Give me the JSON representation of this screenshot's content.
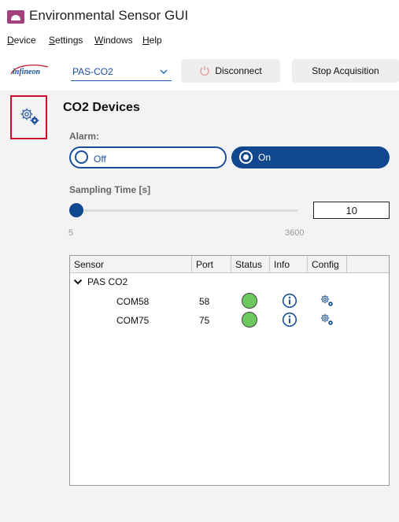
{
  "app": {
    "title": "Environmental Sensor GUI",
    "accent": "#a3417f"
  },
  "menu": {
    "items": [
      {
        "mnemonic": "D",
        "rest": "evice"
      },
      {
        "mnemonic": "S",
        "rest": "ettings"
      },
      {
        "mnemonic": "W",
        "rest": "indows"
      },
      {
        "mnemonic": "H",
        "rest": "elp"
      }
    ]
  },
  "toolbar": {
    "logo_text": "infineon",
    "device_value": "PAS-CO2",
    "disconnect_label": "Disconnect",
    "stop_label": "Stop Acquisition"
  },
  "sidebar": {
    "settings_icon": "gear-icon"
  },
  "panel": {
    "title": "CO2 Devices",
    "alarm_label": "Alarm:",
    "alarm_off": "Off",
    "alarm_on": "On",
    "alarm_selected": "On",
    "sampling_label": "Sampling Time [s]",
    "sampling_value": "10",
    "sampling_min": "5",
    "sampling_max": "3600"
  },
  "table": {
    "headers": [
      "Sensor",
      "Port",
      "Status",
      "Info",
      "Config"
    ],
    "group": "PAS CO2",
    "rows": [
      {
        "sensor": "COM58",
        "port": "58",
        "status_color": "#6cc95e"
      },
      {
        "sensor": "COM75",
        "port": "75",
        "status_color": "#6cc95e"
      }
    ]
  },
  "colors": {
    "primary": "#11478f",
    "highlight": "#c8102e",
    "status_ok": "#6cc95e"
  }
}
